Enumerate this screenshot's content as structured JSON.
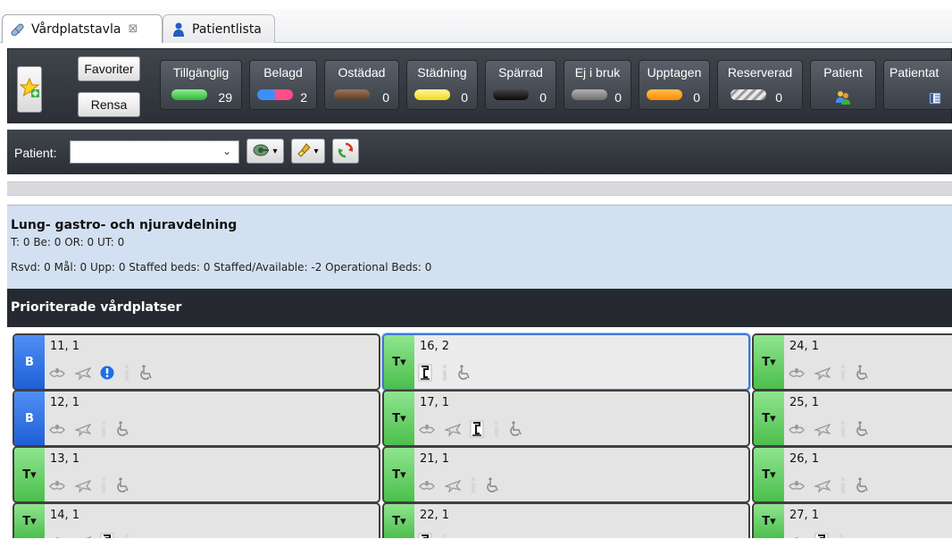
{
  "tabs": [
    {
      "label": "Vårdplatstavla",
      "close": "⊠"
    },
    {
      "label": "Patientlista"
    }
  ],
  "toolbar": {
    "favoriter": "Favoriter",
    "rensa": "Rensa",
    "statuses": [
      {
        "label": "Tillgänglig",
        "count": "29",
        "color": "#4fd15a"
      },
      {
        "label": "Belagd",
        "count": "2",
        "color": "split"
      },
      {
        "label": "Ostädad",
        "count": "0",
        "color": "#6b4a34"
      },
      {
        "label": "Städning",
        "count": "0",
        "color": "#f4e84a"
      },
      {
        "label": "Spärrad",
        "count": "0",
        "color": "#111111"
      },
      {
        "label": "Ej i bruk",
        "count": "0",
        "color": "#8a8a8a"
      },
      {
        "label": "Upptagen",
        "count": "0",
        "color": "#ff9900"
      },
      {
        "label": "Reserverad",
        "count": "0",
        "color": "striped"
      },
      {
        "label": "Patient",
        "icon": "patient-group-icon"
      },
      {
        "label": "Patientat",
        "icon": "patient-info-icon"
      }
    ]
  },
  "patient_row": {
    "label": "Patient:",
    "value": ""
  },
  "department": {
    "name": "Lung- gastro- och njuravdelning",
    "line1": "T: 0 Be: 0 OR: 0 UT: 0",
    "line2": "Rsvd: 0 Mål: 0 Upp: 0 Staffed beds: 0 Staffed/Available: -2 Operational Beds: 0"
  },
  "section_title": "Prioriterade vårdplatser",
  "beds": [
    {
      "id": "11, 1",
      "status": "B",
      "icons": [
        "hands",
        "plane",
        "alert",
        "info",
        "wheelchair"
      ]
    },
    {
      "id": "16, 2",
      "status": "T▾",
      "icons": [
        "bed-side",
        "info",
        "wheelchair"
      ],
      "selected": true
    },
    {
      "id": "24, 1",
      "status": "T▾",
      "icons": [
        "hands",
        "plane",
        "info",
        "wheelchair"
      ]
    },
    {
      "id": "12, 1",
      "status": "B",
      "icons": [
        "hands",
        "plane",
        "info",
        "wheelchair"
      ]
    },
    {
      "id": "17, 1",
      "status": "T▾",
      "icons": [
        "hands",
        "plane",
        "bed-side",
        "info",
        "wheelchair"
      ]
    },
    {
      "id": "25, 1",
      "status": "T▾",
      "icons": [
        "hands",
        "plane",
        "info",
        "wheelchair"
      ]
    },
    {
      "id": "13, 1",
      "status": "T▾",
      "icons": [
        "hands",
        "plane",
        "info",
        "wheelchair"
      ]
    },
    {
      "id": "21, 1",
      "status": "T▾",
      "icons": [
        "hands",
        "plane",
        "info",
        "wheelchair"
      ]
    },
    {
      "id": "26, 1",
      "status": "T▾",
      "icons": [
        "hands",
        "plane",
        "info",
        "wheelchair"
      ]
    },
    {
      "id": "14, 1",
      "status": "T▾",
      "icons": [
        "hands",
        "plane",
        "bed-side",
        "info"
      ]
    },
    {
      "id": "22, 1",
      "status": "T▾",
      "icons": [
        "bed-side",
        "info"
      ]
    },
    {
      "id": "27, 1",
      "status": "T▾",
      "icons": [
        "hands",
        "bed-side",
        "info"
      ]
    }
  ]
}
